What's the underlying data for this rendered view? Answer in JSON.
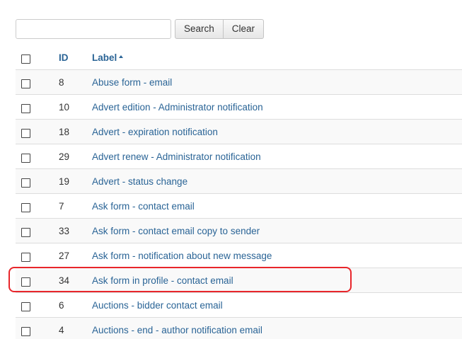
{
  "search": {
    "value": "",
    "placeholder": "",
    "search_label": "Search",
    "clear_label": "Clear"
  },
  "table": {
    "columns": {
      "id": "ID",
      "label": "Label"
    },
    "sort": {
      "column": "label",
      "direction": "ascending",
      "indicator_icon": "caret-up-icon"
    },
    "rows": [
      {
        "id": "8",
        "label": "Abuse form - email",
        "checked": false
      },
      {
        "id": "10",
        "label": "Advert edition - Administrator notification",
        "checked": false
      },
      {
        "id": "18",
        "label": "Advert - expiration notification",
        "checked": false
      },
      {
        "id": "29",
        "label": "Advert renew - Administrator notification",
        "checked": false
      },
      {
        "id": "19",
        "label": "Advert - status change",
        "checked": false
      },
      {
        "id": "7",
        "label": "Ask form - contact email",
        "checked": false
      },
      {
        "id": "33",
        "label": "Ask form - contact email copy to sender",
        "checked": false
      },
      {
        "id": "27",
        "label": "Ask form - notification about new message",
        "checked": false
      },
      {
        "id": "34",
        "label": "Ask form in profile - contact email",
        "checked": false,
        "highlighted": true
      },
      {
        "id": "6",
        "label": "Auctions - bidder contact email",
        "checked": false
      },
      {
        "id": "4",
        "label": "Auctions - end - author notification email",
        "checked": false
      }
    ]
  },
  "colors": {
    "link": "#2a6496",
    "row_stripe": "#f9f9f9",
    "border": "#dddddd",
    "highlight": "#e8262b"
  }
}
